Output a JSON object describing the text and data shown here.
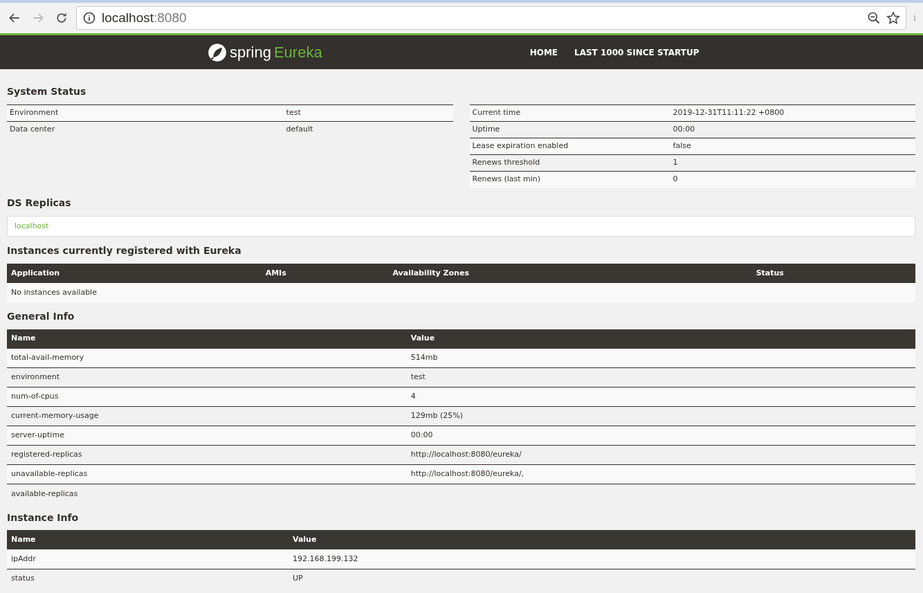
{
  "browser": {
    "url_host": "localhost",
    "url_port": ":8080"
  },
  "navbar": {
    "brand_word": "spring",
    "brand_product": "Eureka",
    "links": [
      "HOME",
      "LAST 1000 SINCE STARTUP"
    ]
  },
  "system_status": {
    "title": "System Status",
    "left_rows": [
      {
        "name": "Environment",
        "value": "test"
      },
      {
        "name": "Data center",
        "value": "default"
      }
    ],
    "right_rows": [
      {
        "name": "Current time",
        "value": "2019-12-31T11:11:22 +0800"
      },
      {
        "name": "Uptime",
        "value": "00:00"
      },
      {
        "name": "Lease expiration enabled",
        "value": "false"
      },
      {
        "name": "Renews threshold",
        "value": "1"
      },
      {
        "name": "Renews (last min)",
        "value": "0"
      }
    ]
  },
  "ds_replicas": {
    "title": "DS Replicas",
    "replicas": [
      "localhost"
    ]
  },
  "instances": {
    "title": "Instances currently registered with Eureka",
    "columns": [
      "Application",
      "AMIs",
      "Availability Zones",
      "Status"
    ],
    "empty_message": "No instances available"
  },
  "general_info": {
    "title": "General Info",
    "columns": [
      "Name",
      "Value"
    ],
    "rows": [
      [
        "total-avail-memory",
        "514mb"
      ],
      [
        "environment",
        "test"
      ],
      [
        "num-of-cpus",
        "4"
      ],
      [
        "current-memory-usage",
        "129mb (25%)"
      ],
      [
        "server-uptime",
        "00:00"
      ],
      [
        "registered-replicas",
        "http://localhost:8080/eureka/"
      ],
      [
        "unavailable-replicas",
        "http://localhost:8080/eureka/,"
      ],
      [
        "available-replicas",
        ""
      ]
    ]
  },
  "instance_info": {
    "title": "Instance Info",
    "columns": [
      "Name",
      "Value"
    ],
    "rows": [
      [
        "ipAddr",
        "192.168.199.132"
      ],
      [
        "status",
        "UP"
      ]
    ]
  }
}
